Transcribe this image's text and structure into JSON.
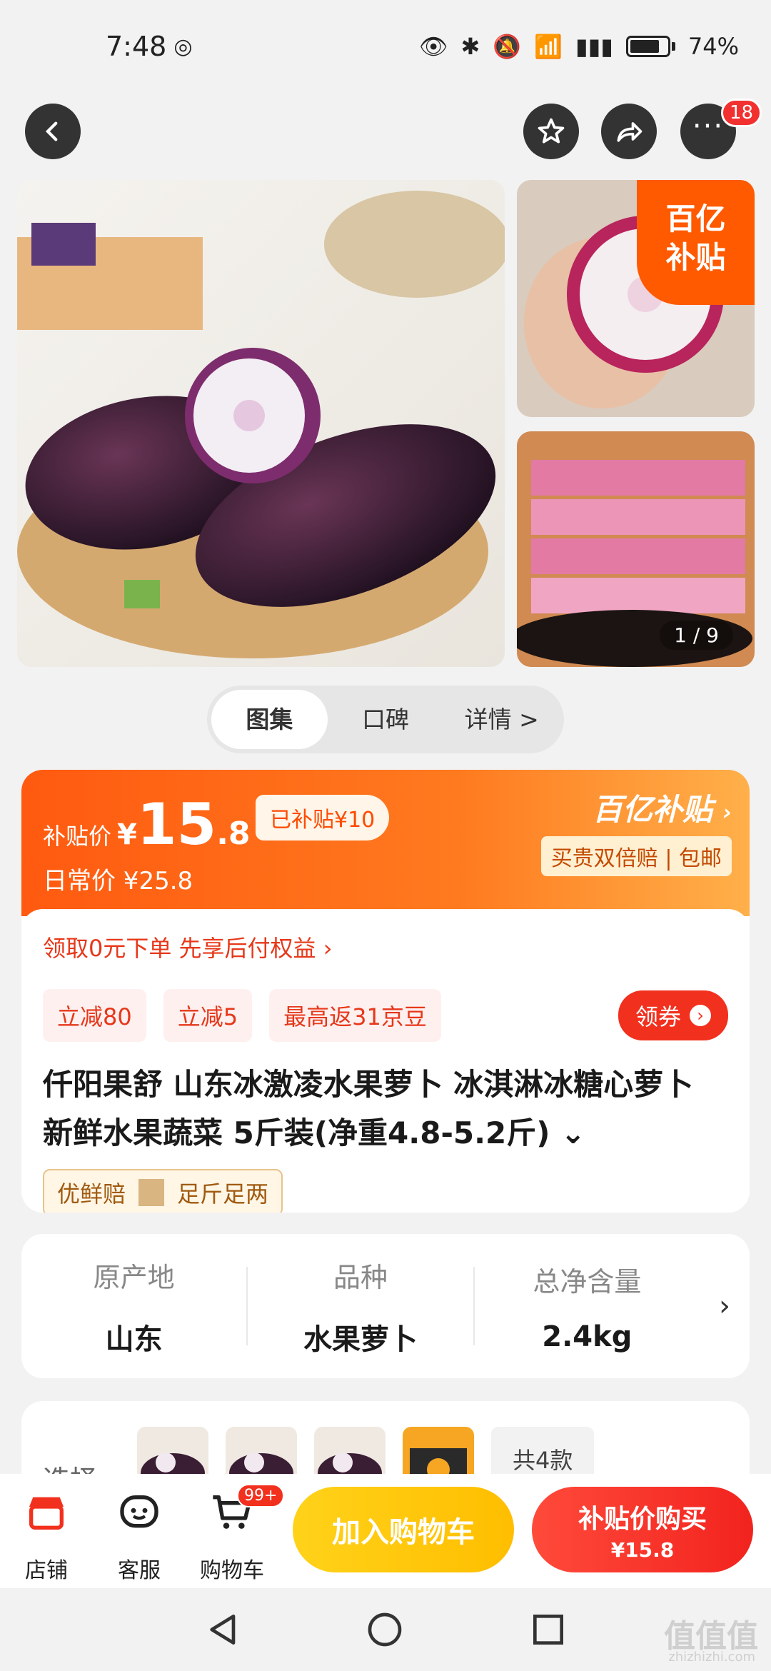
{
  "status": {
    "time": "7:48",
    "battery": "74%"
  },
  "header": {
    "more_badge": "18"
  },
  "gallery": {
    "corner_line1": "百亿",
    "corner_line2": "补贴",
    "page": "1 / 9"
  },
  "tabs": [
    {
      "label": "图集"
    },
    {
      "label": "口碑"
    },
    {
      "label": "详情 >"
    }
  ],
  "price": {
    "label": "补贴价",
    "yen": "¥",
    "integer": "15",
    "decimal": ".8",
    "subsidized": "已补贴¥10",
    "daily": "日常价 ¥25.8",
    "brand": "百亿补贴",
    "brand_sub": "买贵双倍赔 | 包邮"
  },
  "promo": {
    "text": "领取0元下单 先享后付权益 ›"
  },
  "coupons": [
    {
      "label": "立减80"
    },
    {
      "label": "立减5"
    },
    {
      "label": "最高返31京豆"
    }
  ],
  "coupon_button": "领券",
  "product": {
    "title": "仟阳果舒 山东冰激凌水果萝卜 冰淇淋冰糖心萝卜 新鲜水果蔬菜 5斤装(净重4.8-5.2斤) ⌄",
    "tags": [
      "优鲜赔",
      "足斤足两"
    ]
  },
  "attributes": [
    {
      "key": "原产地",
      "value": "山东"
    },
    {
      "key": "品种",
      "value": "水果萝卜"
    },
    {
      "key": "总净含量",
      "value": "2.4kg"
    }
  ],
  "select": {
    "label": "选择",
    "total": "共4款"
  },
  "bottom": {
    "store": "店铺",
    "service": "客服",
    "cart": "购物车",
    "cart_badge": "99+",
    "add_to_cart": "加入购物车",
    "buy_line1": "补贴价购买",
    "buy_line2": "¥15.8"
  },
  "watermark": {
    "main": "值值值",
    "sub": "zhizhizhi.com"
  }
}
